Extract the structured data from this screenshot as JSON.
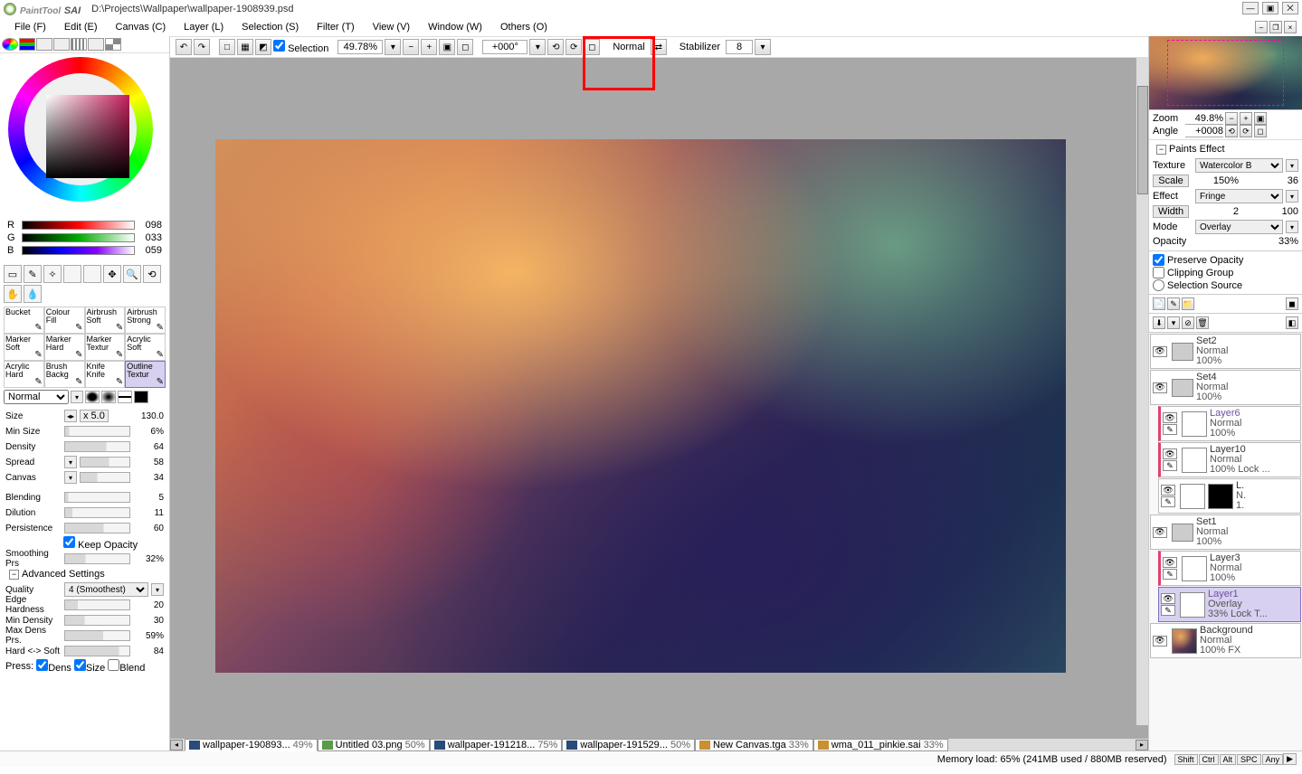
{
  "app": {
    "name_prefix": "PaintTool",
    "name": "SAI",
    "filepath": "D:\\Projects\\Wallpaper\\wallpaper-1908939.psd"
  },
  "menu": {
    "file": "File (F)",
    "edit": "Edit (E)",
    "canvas": "Canvas (C)",
    "layer": "Layer (L)",
    "selection": "Selection (S)",
    "filter": "Filter (T)",
    "view": "View (V)",
    "window": "Window (W)",
    "others": "Others (O)"
  },
  "toolbar": {
    "selection_label": "Selection",
    "zoom": "49.78%",
    "rotation": "+000°",
    "mode_label": "Normal",
    "stabilizer_label": "Stabilizer",
    "stabilizer_value": "8"
  },
  "rgb": {
    "r_lbl": "R",
    "r_val": "098",
    "g_lbl": "G",
    "g_val": "033",
    "b_lbl": "B",
    "b_val": "059"
  },
  "swatch": {
    "primary": "#5a2238",
    "secondary": "#d89048"
  },
  "tools": [
    {
      "label": "Bucket"
    },
    {
      "label": "Colour Fill"
    },
    {
      "label": "Airbrush Soft"
    },
    {
      "label": "Airbrush Strong"
    },
    {
      "label": "Marker Soft"
    },
    {
      "label": "Marker Hard"
    },
    {
      "label": "Marker Textur"
    },
    {
      "label": "Acrylic Soft"
    },
    {
      "label": "Acrylic Hard"
    },
    {
      "label": "Brush Backg"
    },
    {
      "label": "Knife Knife"
    },
    {
      "label": "Outline Textur",
      "sel": true
    }
  ],
  "brush": {
    "mode_label": "Normal",
    "size_lbl": "Size",
    "size_mult": "x 5.0",
    "size_val": "130.0",
    "minsize_lbl": "Min Size",
    "minsize_val": "6%",
    "density_lbl": "Density",
    "density_val": "64",
    "spread_lbl": "Spread",
    "spread_val": "58",
    "canvas_lbl": "Canvas",
    "canvas_val": "34",
    "blending_lbl": "Blending",
    "blending_val": "5",
    "dilution_lbl": "Dilution",
    "dilution_val": "11",
    "persist_lbl": "Persistence",
    "persist_val": "60",
    "keepopac_lbl": "Keep Opacity",
    "smooth_lbl": "Smoothing Prs",
    "smooth_val": "32%",
    "adv_lbl": "Advanced Settings",
    "quality_lbl": "Quality",
    "quality_val": "4 (Smoothest)",
    "edge_lbl": "Edge Hardness",
    "edge_val": "20",
    "mindens_lbl": "Min Density",
    "mindens_val": "30",
    "maxdens_lbl": "Max Dens Prs.",
    "maxdens_val": "59%",
    "hard_lbl": "Hard <-> Soft",
    "hard_val": "84",
    "press_lbl": "Press:",
    "press_dens": "Dens",
    "press_size": "Size",
    "press_blend": "Blend"
  },
  "nav": {
    "zoom_lbl": "Zoom",
    "zoom_val": "49.8%",
    "angle_lbl": "Angle",
    "angle_val": "+0008"
  },
  "paints": {
    "header": "Paints Effect",
    "texture_lbl": "Texture",
    "texture_val": "Watercolor B",
    "scale_lbl": "Scale",
    "scale_val": "150%",
    "scale_num": "36",
    "effect_lbl": "Effect",
    "effect_val": "Fringe",
    "width_lbl": "Width",
    "width_val": "2",
    "width_num": "100",
    "mode_lbl": "Mode",
    "mode_val": "Overlay",
    "opacity_lbl": "Opacity",
    "opacity_val": "33%",
    "preserve_lbl": "Preserve Opacity",
    "clipping_lbl": "Clipping Group",
    "selsrc_lbl": "Selection Source"
  },
  "layers": [
    {
      "type": "group",
      "name": "Set2",
      "mode": "Normal",
      "opac": "100%"
    },
    {
      "type": "group",
      "name": "Set4",
      "mode": "Normal",
      "opac": "100%"
    },
    {
      "type": "layer",
      "name": "Layer6",
      "mode": "Normal",
      "opac": "100%",
      "child": true,
      "red": true,
      "purple": true
    },
    {
      "type": "layer",
      "name": "Layer10",
      "mode": "Normal",
      "opac": "100% Lock ...",
      "child": true,
      "red": true
    },
    {
      "type": "layer",
      "name": "L.",
      "mode": "N.",
      "opac": "1.",
      "child": true,
      "small": true
    },
    {
      "type": "group",
      "name": "Set1",
      "mode": "Normal",
      "opac": "100%"
    },
    {
      "type": "layer",
      "name": "Layer3",
      "mode": "Normal",
      "opac": "100%",
      "child": true,
      "red": true
    },
    {
      "type": "layer",
      "name": "Layer1",
      "mode": "Overlay",
      "opac": "33%   Lock T...",
      "child": true,
      "sel": true,
      "purple": true
    },
    {
      "type": "layer",
      "name": "Background",
      "mode": "Normal",
      "opac": "100% FX",
      "bg": true
    }
  ],
  "tabs": [
    {
      "name": "wallpaper-190893...",
      "pct": "49%",
      "active": true,
      "icon": "ps"
    },
    {
      "name": "Untitled 03.png",
      "pct": "50%",
      "icon": "img"
    },
    {
      "name": "wallpaper-191218...",
      "pct": "75%",
      "icon": "ps"
    },
    {
      "name": "wallpaper-191529...",
      "pct": "50%",
      "icon": "ps"
    },
    {
      "name": "New Canvas.tga",
      "pct": "33%",
      "icon": "sai"
    },
    {
      "name": "wma_011_pinkie.sai",
      "pct": "33%",
      "icon": "sai"
    }
  ],
  "status": {
    "memory": "Memory load: 65% (241MB used / 880MB reserved)",
    "keys": [
      "Shift",
      "Ctrl",
      "Alt",
      "SPC",
      "Any"
    ],
    "key_symbol": "▶"
  }
}
